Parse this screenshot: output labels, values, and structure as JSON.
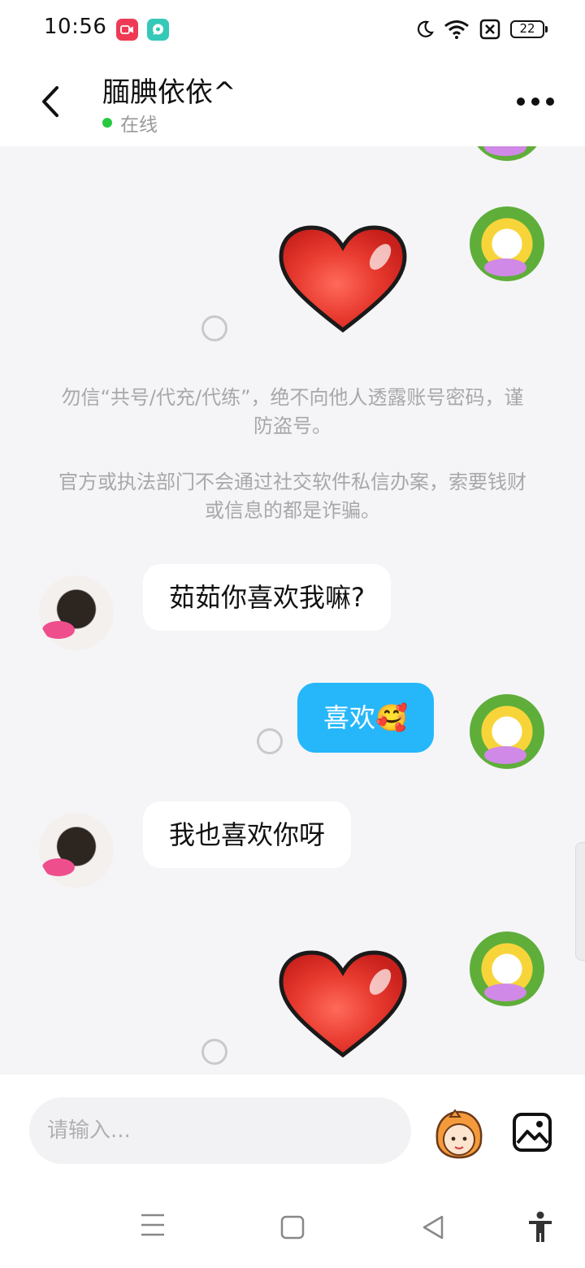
{
  "status_bar": {
    "time": "10:56",
    "battery": "22",
    "icons": [
      "screen-record-icon",
      "chat-app-icon",
      "moon-icon",
      "wifi-icon",
      "no-sim-icon",
      "battery-icon"
    ]
  },
  "header": {
    "title": "腼腆依依^",
    "status": "在线"
  },
  "chat": {
    "notice": {
      "line1": "勿信“共号/代充/代练”，绝不向他人透露账号密码，谨防盗号。",
      "line2": "官方或执法部门不会通过社交软件私信办案，索要钱财或信息的都是诈骗。"
    },
    "messages": [
      {
        "sender": "me",
        "type": "sticker",
        "content": "heart-sticker"
      },
      {
        "sender": "them",
        "type": "text",
        "text": "茹茹你喜欢我嘛?"
      },
      {
        "sender": "me",
        "type": "text",
        "text": "喜欢🥰"
      },
      {
        "sender": "them",
        "type": "text",
        "text": "我也喜欢你呀"
      },
      {
        "sender": "me",
        "type": "sticker",
        "content": "heart-sticker"
      }
    ]
  },
  "composer": {
    "placeholder": "请输入..."
  },
  "colors": {
    "outgoing_bubble": "#26b7fb",
    "incoming_bubble": "#ffffff",
    "online_dot": "#27c93f",
    "background": "#f5f5f7"
  }
}
